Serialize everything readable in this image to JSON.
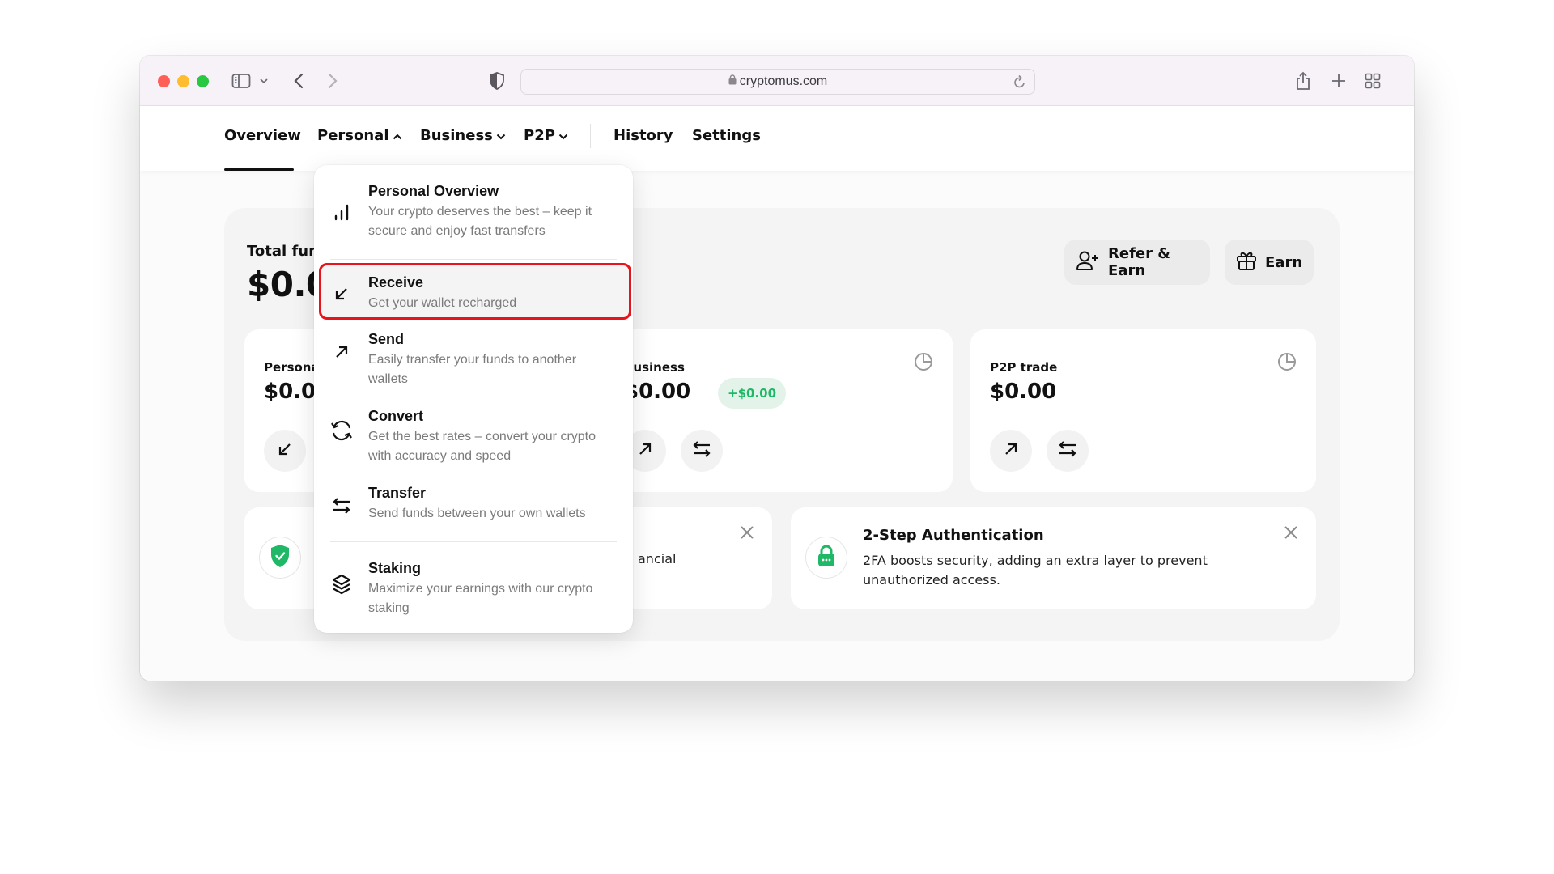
{
  "browser": {
    "url": "cryptomus.com",
    "icons": [
      "sidebar-icon",
      "chevron-down-icon",
      "back-icon",
      "forward-icon",
      "shield-icon",
      "lock-icon",
      "reload-icon",
      "share-icon",
      "new-tab-icon",
      "tab-overview-icon"
    ]
  },
  "nav": {
    "items": [
      {
        "label": "Overview",
        "active": true
      },
      {
        "label": "Personal",
        "chevron": "up"
      },
      {
        "label": "Business",
        "chevron": "down"
      },
      {
        "label": "P2P",
        "chevron": "down"
      },
      {
        "label": "History"
      },
      {
        "label": "Settings"
      }
    ]
  },
  "dashboard": {
    "total_label": "Total funds",
    "total_value": "$0.00",
    "buttons": {
      "refer": "Refer & Earn",
      "earn": "Earn"
    },
    "cards": [
      {
        "title": "Personal",
        "value": "$0.00"
      },
      {
        "title": "Business",
        "value": "$0.00",
        "badge": "+$0.00"
      },
      {
        "title": "P2P trade",
        "value": "$0.00"
      }
    ],
    "notifications": [
      {
        "text_fragment": "ancial"
      },
      {
        "title": "2-Step Authentication",
        "text": "2FA boosts security, adding an extra layer to prevent unauthorized access."
      }
    ]
  },
  "menu": {
    "items": [
      {
        "title": "Personal Overview",
        "desc": "Your crypto deserves the best – keep it secure and enjoy fast transfers",
        "icon": "bar-chart-icon"
      },
      {
        "title": "Receive",
        "desc": "Get your wallet recharged",
        "icon": "arrow-down-left-icon",
        "highlighted": true
      },
      {
        "title": "Send",
        "desc": "Easily transfer your funds to another wallets",
        "icon": "arrow-up-right-icon"
      },
      {
        "title": "Convert",
        "desc": "Get the best rates – convert your crypto with accuracy and speed",
        "icon": "convert-icon"
      },
      {
        "title": "Transfer",
        "desc": "Send funds between your own wallets",
        "icon": "transfer-icon"
      },
      {
        "title": "Staking",
        "desc": "Maximize your earnings with our crypto staking",
        "icon": "layers-icon"
      }
    ]
  },
  "colors": {
    "highlight_border": "#e8141c",
    "positive": "#1fb866",
    "positive_bg": "#e3f3ea",
    "security_green": "#1fb866"
  }
}
